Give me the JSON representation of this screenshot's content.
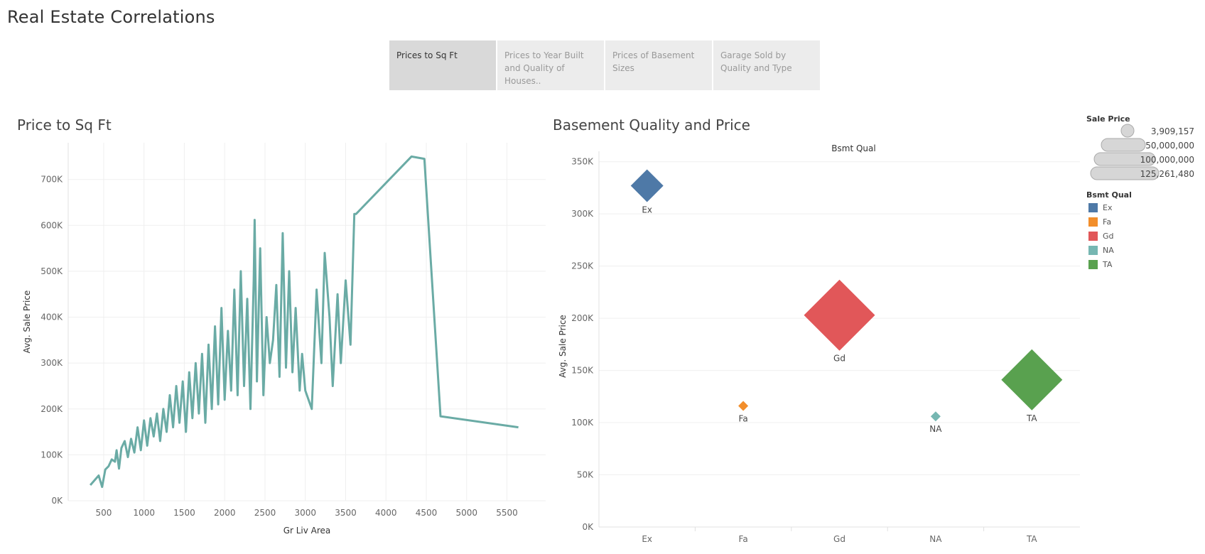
{
  "dashboard": {
    "title": "Real Estate Correlations"
  },
  "tabs": [
    {
      "label": "Prices to Sq Ft",
      "active": true
    },
    {
      "label": "Prices to Year Built and Quality of Houses..",
      "active": false
    },
    {
      "label": "Prices of Basement Sizes",
      "active": false
    },
    {
      "label": "Garage Sold by Quality and Type",
      "active": false
    }
  ],
  "left_chart": {
    "title": "Price to Sq Ft"
  },
  "right_chart": {
    "title": "Basement Quality and Price"
  },
  "legend": {
    "size_title": "Sale Price",
    "size_values": [
      "3,909,157",
      "50,000,000",
      "100,000,000",
      "125,261,480"
    ],
    "color_title": "Bsmt Qual",
    "color_items": [
      {
        "label": "Ex",
        "color": "#4e79a7"
      },
      {
        "label": "Fa",
        "color": "#f28e2b"
      },
      {
        "label": "Gd",
        "color": "#e15759"
      },
      {
        "label": "NA",
        "color": "#76b7b2"
      },
      {
        "label": "TA",
        "color": "#59a14f"
      }
    ]
  },
  "chart_data": [
    {
      "type": "line",
      "title": "Price to Sq Ft",
      "xlabel": "Gr Liv Area",
      "ylabel": "Avg. Sale Price",
      "xlim": [
        60,
        5980
      ],
      "ylim": [
        0,
        780000
      ],
      "x_ticks": [
        500,
        1000,
        1500,
        2000,
        2500,
        3000,
        3500,
        4000,
        4500,
        5000,
        5500
      ],
      "x_tick_labels": [
        "500",
        "1000",
        "1500",
        "2000",
        "2500",
        "3000",
        "3500",
        "4000",
        "4500",
        "5000",
        "5500"
      ],
      "y_ticks": [
        0,
        100000,
        200000,
        300000,
        400000,
        500000,
        600000,
        700000
      ],
      "y_tick_labels": [
        "0K",
        "100K",
        "200K",
        "300K",
        "400K",
        "500K",
        "600K",
        "700K"
      ],
      "grid": true,
      "color": "#6aaba5",
      "x": [
        334,
        438,
        480,
        520,
        560,
        600,
        640,
        660,
        690,
        720,
        760,
        800,
        840,
        880,
        920,
        960,
        1000,
        1040,
        1080,
        1120,
        1160,
        1200,
        1240,
        1280,
        1320,
        1360,
        1400,
        1440,
        1480,
        1520,
        1560,
        1600,
        1640,
        1680,
        1720,
        1760,
        1800,
        1840,
        1880,
        1920,
        1960,
        2000,
        2040,
        2080,
        2120,
        2160,
        2200,
        2240,
        2280,
        2320,
        2360,
        2372,
        2400,
        2440,
        2480,
        2520,
        2560,
        2600,
        2640,
        2680,
        2720,
        2760,
        2800,
        2840,
        2880,
        2930,
        2960,
        3000,
        3080,
        3140,
        3200,
        3240,
        3300,
        3340,
        3400,
        3440,
        3500,
        3560,
        3608,
        3630,
        4316,
        4476,
        4676,
        5642
      ],
      "y": [
        34000,
        55000,
        30000,
        68000,
        75000,
        90000,
        85000,
        110000,
        70000,
        115000,
        130000,
        95000,
        135000,
        105000,
        160000,
        110000,
        175000,
        120000,
        180000,
        140000,
        190000,
        130000,
        200000,
        150000,
        230000,
        160000,
        250000,
        170000,
        260000,
        150000,
        280000,
        180000,
        300000,
        190000,
        320000,
        170000,
        340000,
        200000,
        380000,
        210000,
        420000,
        220000,
        370000,
        240000,
        460000,
        230000,
        500000,
        250000,
        440000,
        200000,
        480000,
        612000,
        260000,
        550000,
        230000,
        400000,
        300000,
        350000,
        470000,
        270000,
        583000,
        290000,
        500000,
        280000,
        420000,
        240000,
        320000,
        240000,
        200000,
        460000,
        300000,
        540000,
        400000,
        250000,
        450000,
        300000,
        480000,
        340000,
        625000,
        625000,
        750000,
        745000,
        184000,
        160000
      ]
    },
    {
      "type": "scatter",
      "title": "Basement Quality and Price",
      "header": "Bsmt Qual",
      "ylabel": "Avg. Sale Price",
      "categories": [
        "Ex",
        "Fa",
        "Gd",
        "NA",
        "TA"
      ],
      "values": [
        327000,
        116000,
        203000,
        106000,
        141000
      ],
      "sizes": [
        23,
        7,
        50,
        7,
        43
      ],
      "ylim": [
        0,
        360000
      ],
      "y_ticks": [
        0,
        50000,
        100000,
        150000,
        200000,
        250000,
        300000,
        350000
      ],
      "y_tick_labels": [
        "0K",
        "50K",
        "100K",
        "150K",
        "200K",
        "250K",
        "300K",
        "350K"
      ],
      "grid": true,
      "legend": "right"
    }
  ]
}
